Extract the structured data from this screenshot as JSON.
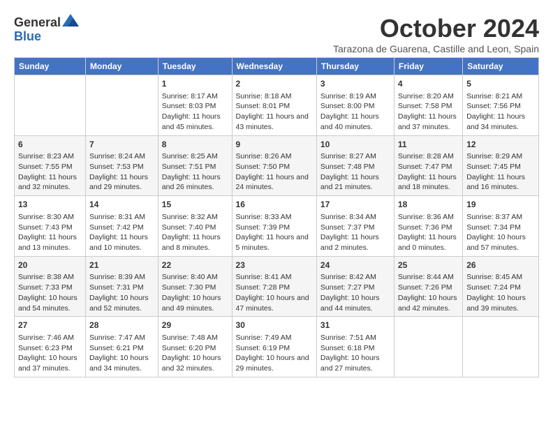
{
  "header": {
    "logo": {
      "line1": "General",
      "line2": "Blue"
    },
    "title": "October 2024",
    "subtitle": "Tarazona de Guarena, Castille and Leon, Spain"
  },
  "days_of_week": [
    "Sunday",
    "Monday",
    "Tuesday",
    "Wednesday",
    "Thursday",
    "Friday",
    "Saturday"
  ],
  "weeks": [
    [
      {
        "day": "",
        "content": ""
      },
      {
        "day": "",
        "content": ""
      },
      {
        "day": "1",
        "content": "Sunrise: 8:17 AM\nSunset: 8:03 PM\nDaylight: 11 hours and 45 minutes."
      },
      {
        "day": "2",
        "content": "Sunrise: 8:18 AM\nSunset: 8:01 PM\nDaylight: 11 hours and 43 minutes."
      },
      {
        "day": "3",
        "content": "Sunrise: 8:19 AM\nSunset: 8:00 PM\nDaylight: 11 hours and 40 minutes."
      },
      {
        "day": "4",
        "content": "Sunrise: 8:20 AM\nSunset: 7:58 PM\nDaylight: 11 hours and 37 minutes."
      },
      {
        "day": "5",
        "content": "Sunrise: 8:21 AM\nSunset: 7:56 PM\nDaylight: 11 hours and 34 minutes."
      }
    ],
    [
      {
        "day": "6",
        "content": "Sunrise: 8:23 AM\nSunset: 7:55 PM\nDaylight: 11 hours and 32 minutes."
      },
      {
        "day": "7",
        "content": "Sunrise: 8:24 AM\nSunset: 7:53 PM\nDaylight: 11 hours and 29 minutes."
      },
      {
        "day": "8",
        "content": "Sunrise: 8:25 AM\nSunset: 7:51 PM\nDaylight: 11 hours and 26 minutes."
      },
      {
        "day": "9",
        "content": "Sunrise: 8:26 AM\nSunset: 7:50 PM\nDaylight: 11 hours and 24 minutes."
      },
      {
        "day": "10",
        "content": "Sunrise: 8:27 AM\nSunset: 7:48 PM\nDaylight: 11 hours and 21 minutes."
      },
      {
        "day": "11",
        "content": "Sunrise: 8:28 AM\nSunset: 7:47 PM\nDaylight: 11 hours and 18 minutes."
      },
      {
        "day": "12",
        "content": "Sunrise: 8:29 AM\nSunset: 7:45 PM\nDaylight: 11 hours and 16 minutes."
      }
    ],
    [
      {
        "day": "13",
        "content": "Sunrise: 8:30 AM\nSunset: 7:43 PM\nDaylight: 11 hours and 13 minutes."
      },
      {
        "day": "14",
        "content": "Sunrise: 8:31 AM\nSunset: 7:42 PM\nDaylight: 11 hours and 10 minutes."
      },
      {
        "day": "15",
        "content": "Sunrise: 8:32 AM\nSunset: 7:40 PM\nDaylight: 11 hours and 8 minutes."
      },
      {
        "day": "16",
        "content": "Sunrise: 8:33 AM\nSunset: 7:39 PM\nDaylight: 11 hours and 5 minutes."
      },
      {
        "day": "17",
        "content": "Sunrise: 8:34 AM\nSunset: 7:37 PM\nDaylight: 11 hours and 2 minutes."
      },
      {
        "day": "18",
        "content": "Sunrise: 8:36 AM\nSunset: 7:36 PM\nDaylight: 11 hours and 0 minutes."
      },
      {
        "day": "19",
        "content": "Sunrise: 8:37 AM\nSunset: 7:34 PM\nDaylight: 10 hours and 57 minutes."
      }
    ],
    [
      {
        "day": "20",
        "content": "Sunrise: 8:38 AM\nSunset: 7:33 PM\nDaylight: 10 hours and 54 minutes."
      },
      {
        "day": "21",
        "content": "Sunrise: 8:39 AM\nSunset: 7:31 PM\nDaylight: 10 hours and 52 minutes."
      },
      {
        "day": "22",
        "content": "Sunrise: 8:40 AM\nSunset: 7:30 PM\nDaylight: 10 hours and 49 minutes."
      },
      {
        "day": "23",
        "content": "Sunrise: 8:41 AM\nSunset: 7:28 PM\nDaylight: 10 hours and 47 minutes."
      },
      {
        "day": "24",
        "content": "Sunrise: 8:42 AM\nSunset: 7:27 PM\nDaylight: 10 hours and 44 minutes."
      },
      {
        "day": "25",
        "content": "Sunrise: 8:44 AM\nSunset: 7:26 PM\nDaylight: 10 hours and 42 minutes."
      },
      {
        "day": "26",
        "content": "Sunrise: 8:45 AM\nSunset: 7:24 PM\nDaylight: 10 hours and 39 minutes."
      }
    ],
    [
      {
        "day": "27",
        "content": "Sunrise: 7:46 AM\nSunset: 6:23 PM\nDaylight: 10 hours and 37 minutes."
      },
      {
        "day": "28",
        "content": "Sunrise: 7:47 AM\nSunset: 6:21 PM\nDaylight: 10 hours and 34 minutes."
      },
      {
        "day": "29",
        "content": "Sunrise: 7:48 AM\nSunset: 6:20 PM\nDaylight: 10 hours and 32 minutes."
      },
      {
        "day": "30",
        "content": "Sunrise: 7:49 AM\nSunset: 6:19 PM\nDaylight: 10 hours and 29 minutes."
      },
      {
        "day": "31",
        "content": "Sunrise: 7:51 AM\nSunset: 6:18 PM\nDaylight: 10 hours and 27 minutes."
      },
      {
        "day": "",
        "content": ""
      },
      {
        "day": "",
        "content": ""
      }
    ]
  ]
}
